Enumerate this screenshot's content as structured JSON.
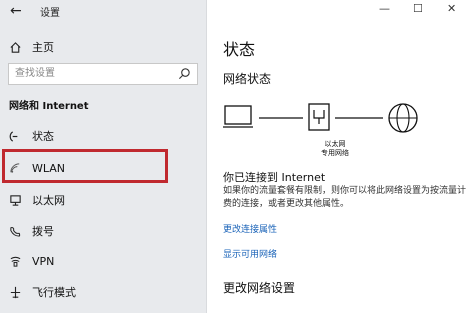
{
  "window": {
    "title": "设置",
    "back_icon": "←",
    "min_icon": "—",
    "max_icon": "☐",
    "close_icon": "✕"
  },
  "nav": {
    "home_label": "主页",
    "search_placeholder": "查找设置",
    "section_title": "网络和 Internet",
    "items": [
      {
        "label": "状态",
        "icon": "status-icon"
      },
      {
        "label": "WLAN",
        "icon": "wifi-icon"
      },
      {
        "label": "以太网",
        "icon": "ethernet-icon"
      },
      {
        "label": "拨号",
        "icon": "dialup-icon"
      },
      {
        "label": "VPN",
        "icon": "vpn-icon"
      },
      {
        "label": "飞行模式",
        "icon": "airplane-icon"
      }
    ],
    "highlight_color": "#c0292f"
  },
  "main": {
    "title": "状态",
    "network_status_heading": "网络状态",
    "diagram_label_line1": "以太网",
    "diagram_label_line2": "专用网络",
    "connected_text": "你已连接到 Internet",
    "description": "如果你的流量套餐有限制，则你可以将此网络设置为按流量计费的连接，或者更改其他属性。",
    "link_change_props": "更改连接属性",
    "link_show_networks": "显示可用网络",
    "change_settings_heading": "更改网络设置",
    "link_color": "#1a63b8"
  }
}
